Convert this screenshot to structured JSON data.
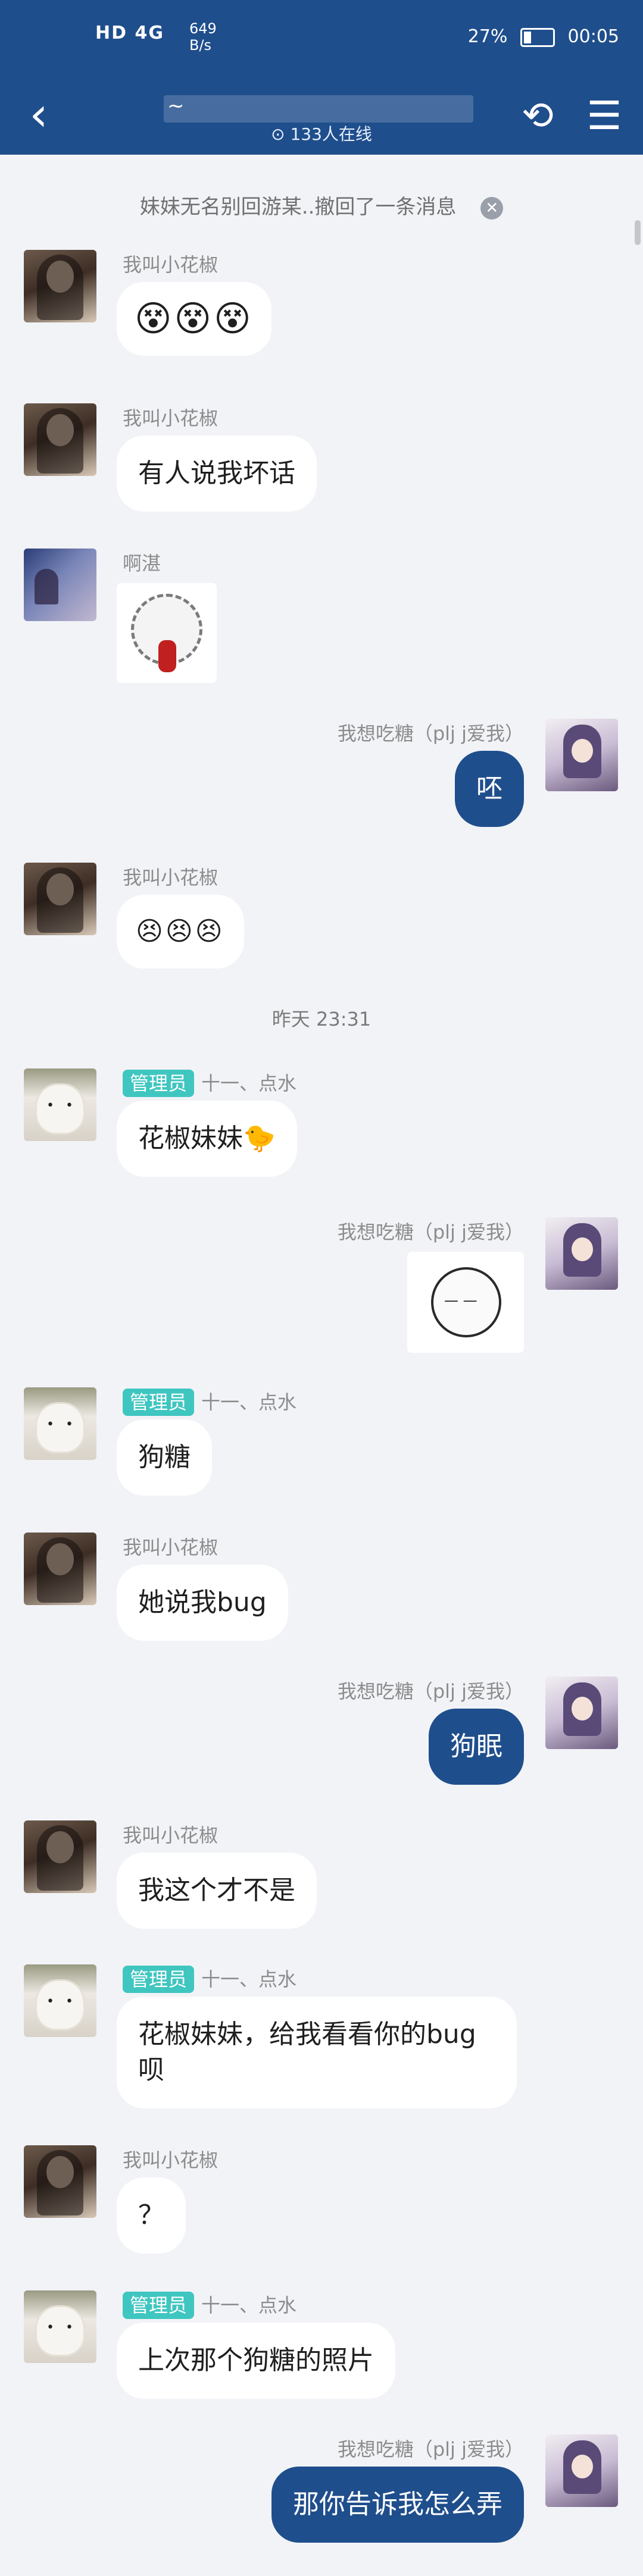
{
  "status_bar": {
    "network": "HD 4G",
    "speed_value": "649",
    "speed_unit": "B/s",
    "battery": "27%",
    "time": "00:05"
  },
  "header": {
    "back_icon": "‹",
    "online": "⊙ 133人在线",
    "sync_icon": "⟲",
    "menu_icon": "☰"
  },
  "notice": {
    "text": "妹妹无名别回游某..撤回了一条消息",
    "close_icon": "✕"
  },
  "time_divider": "昨天 23:31",
  "messages": [
    {
      "sender": "我叫小花椒",
      "stickers": "😵😵😵"
    },
    {
      "sender": "我叫小花椒",
      "text": "有人说我坏话"
    },
    {
      "sender": "啊湛"
    },
    {
      "sender": "我想吃糖（plj j爱我）",
      "text": "呸"
    },
    {
      "sender": "我叫小花椒",
      "stickers": "😣😣😣"
    },
    {
      "badge": "管理员",
      "sender": "十一、点水",
      "text": "花椒妹妹",
      "emoji": "🐤"
    },
    {
      "sender": "我想吃糖（plj j爱我）"
    },
    {
      "badge": "管理员",
      "sender": "十一、点水",
      "text": "狗糖"
    },
    {
      "sender": "我叫小花椒",
      "text": "她说我bug"
    },
    {
      "sender": "我想吃糖（plj j爱我）",
      "text": "狗眠"
    },
    {
      "sender": "我叫小花椒",
      "text": "我这个才不是"
    },
    {
      "badge": "管理员",
      "sender": "十一、点水",
      "text": "花椒妹妹，给我看看你的bug呗"
    },
    {
      "sender": "我叫小花椒",
      "text": "？"
    },
    {
      "badge": "管理员",
      "sender": "十一、点水",
      "text": "上次那个狗糖的照片"
    },
    {
      "sender": "我想吃糖（plj j爱我）",
      "text": "那你告诉我怎么弄"
    }
  ]
}
